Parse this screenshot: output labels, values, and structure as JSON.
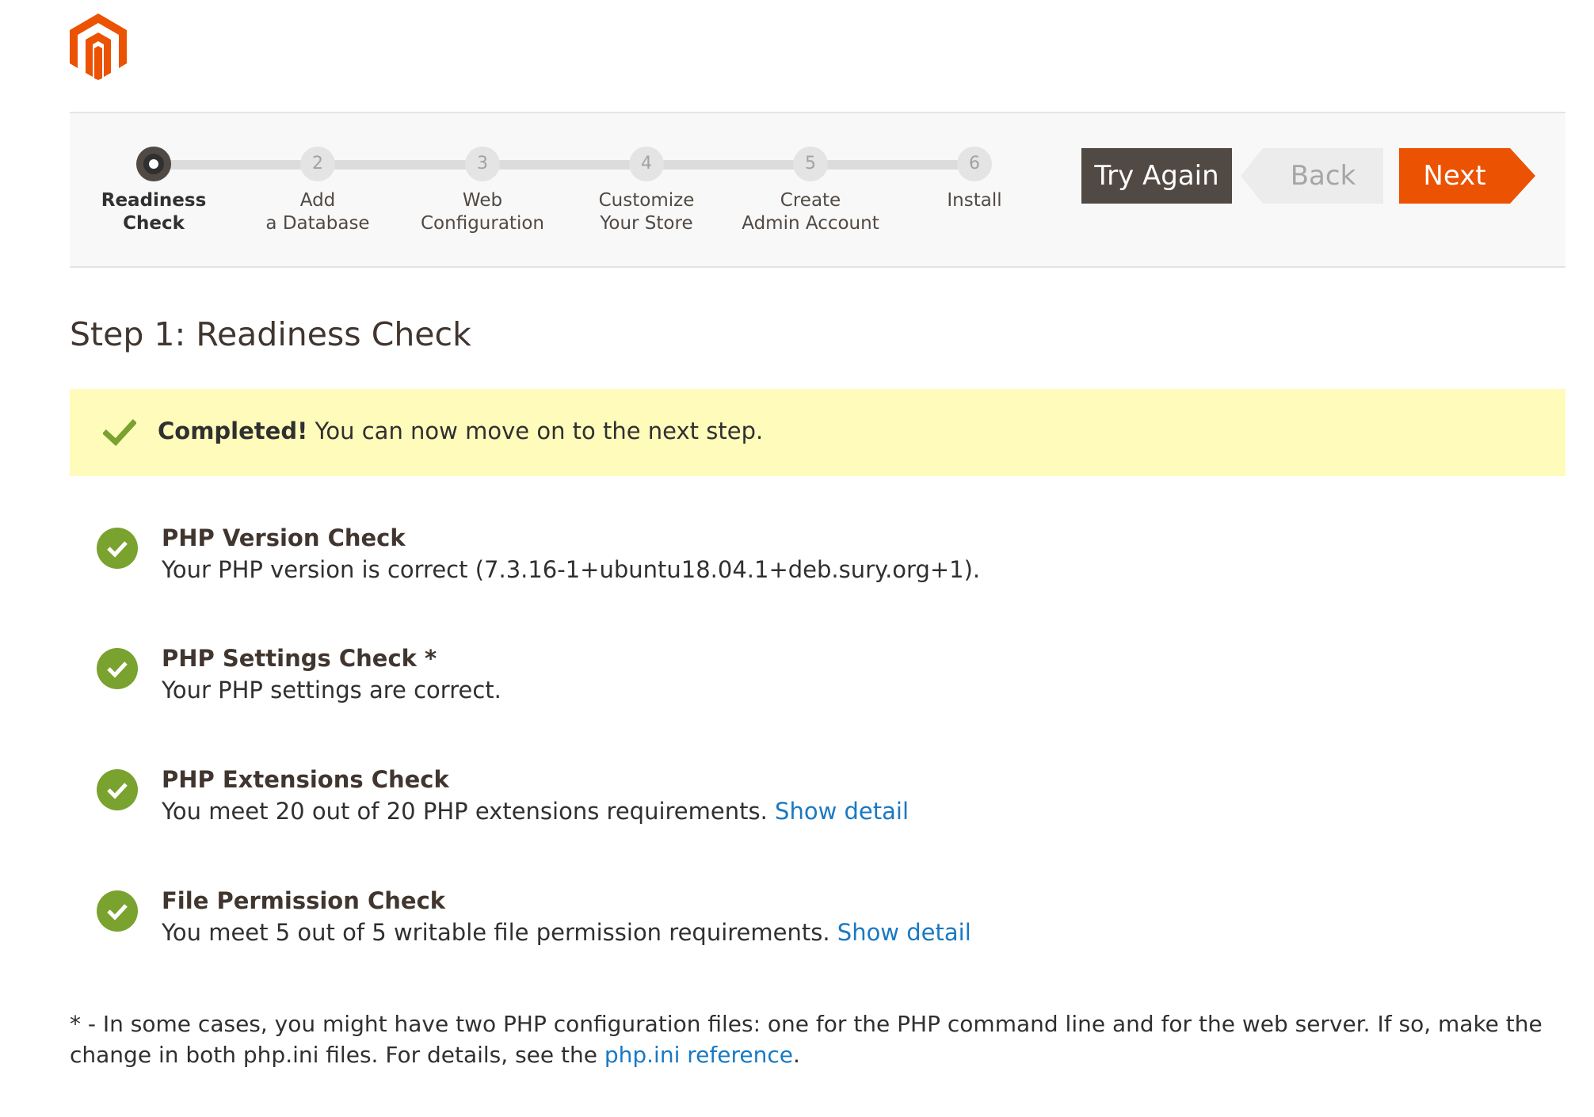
{
  "steps": [
    {
      "number": "",
      "label": "Readiness\nCheck",
      "active": true
    },
    {
      "number": "2",
      "label": "Add\na Database",
      "active": false
    },
    {
      "number": "3",
      "label": "Web\nConfiguration",
      "active": false
    },
    {
      "number": "4",
      "label": "Customize\nYour Store",
      "active": false
    },
    {
      "number": "5",
      "label": "Create\nAdmin Account",
      "active": false
    },
    {
      "number": "6",
      "label": "Install",
      "active": false
    }
  ],
  "buttons": {
    "try_again": "Try Again",
    "back": "Back",
    "next": "Next"
  },
  "page_title": "Step 1: Readiness Check",
  "notice": {
    "strong": "Completed!",
    "text": " You can now move on to the next step."
  },
  "checks": [
    {
      "title": "PHP Version Check",
      "description": "Your PHP version is correct (7.3.16-1+ubuntu18.04.1+deb.sury.org+1).",
      "link": ""
    },
    {
      "title": "PHP Settings Check *",
      "description": "Your PHP settings are correct.",
      "link": ""
    },
    {
      "title": "PHP Extensions Check",
      "description": "You meet 20 out of 20 PHP extensions requirements. ",
      "link": "Show detail"
    },
    {
      "title": "File Permission Check",
      "description": "You meet 5 out of 5 writable file permission requirements. ",
      "link": "Show detail"
    }
  ],
  "footnote": {
    "text": "* - In some cases, you might have two PHP configuration files: one for the PHP command line and for the web server. If so, make the change in both php.ini files. For details, see the ",
    "link": "php.ini reference",
    "end": "."
  },
  "colors": {
    "accent": "#eb5202",
    "dark": "#514943",
    "success": "#79a22e",
    "notice_bg": "#fffbbb",
    "link": "#1979c3"
  }
}
